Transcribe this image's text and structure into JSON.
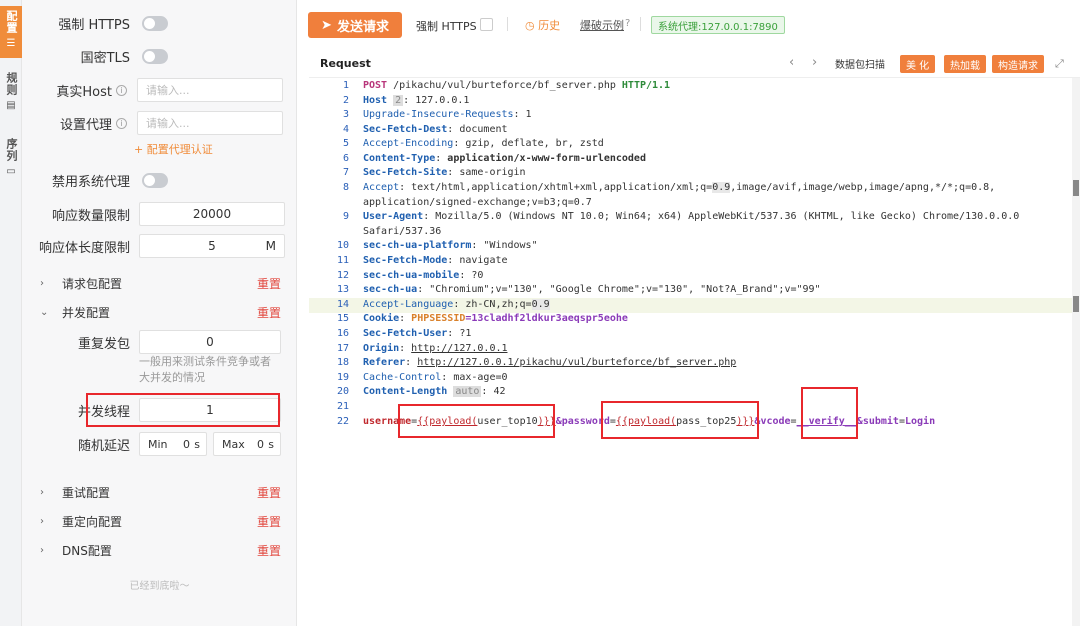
{
  "vtabs": [
    "配置",
    "规则",
    "序列"
  ],
  "settings": {
    "force_https": "强制 HTTPS",
    "gm_tls": "国密TLS",
    "real_host": "真实Host",
    "real_host_placeholder": "请输入...",
    "proxy": "设置代理",
    "proxy_placeholder": "请输入...",
    "proxy_auth": "+ 配置代理认证",
    "disable_sys_proxy": "禁用系统代理",
    "resp_count_label": "响应数量限制",
    "resp_count_value": "20000",
    "resp_len_label": "响应体长度限制",
    "resp_len_value": "5",
    "resp_len_unit": "M"
  },
  "sections": {
    "reqpkg": "请求包配置",
    "concurrency": "并发配置",
    "retry": "重试配置",
    "redirect": "重定向配置",
    "dns": "DNS配置",
    "reset": "重置"
  },
  "concurrency": {
    "repeat_label": "重复发包",
    "repeat_value": "0",
    "hint": "一般用来测试条件竞争或者大并发的情况",
    "threads_label": "并发线程",
    "threads_value": "1",
    "delay_label": "随机延迟",
    "min_label": "Min",
    "min_value": "0",
    "max_label": "Max",
    "max_value": "0",
    "unit": "s"
  },
  "bottom_text": "已经到底啦～",
  "toolbar": {
    "send": "发送请求",
    "force_https": "强制 HTTPS",
    "history": "历史",
    "blast_example": "爆破示例",
    "proxy_tag": "系统代理:127.0.0.1:7890"
  },
  "request": {
    "title": "Request",
    "packet_scan": "数据包扫描",
    "beautify": "美 化",
    "hot_load": "热加载",
    "build_request": "构造请求",
    "prev": "‹",
    "next": "›",
    "expand": "⤢"
  },
  "code": {
    "line_numbers": [
      "1",
      "2",
      "3",
      "4",
      "5",
      "6",
      "7",
      "8",
      "",
      "9",
      "",
      "10",
      "11",
      "12",
      "13",
      "14",
      "15",
      "16",
      "17",
      "18",
      "19",
      "20",
      "21",
      "22"
    ],
    "l1": [
      "POST",
      " /pikachu/vul/burteforce/bf_server.php ",
      "HTTP/1.1"
    ],
    "l2": [
      "Host",
      "2",
      ": 127.0.0.1"
    ],
    "l3": [
      "Upgrade-Insecure-Requests",
      ": 1"
    ],
    "l4": [
      "Sec-Fetch-Dest",
      ": document"
    ],
    "l5": [
      "Accept-Encoding",
      ": gzip, deflate, br, zstd"
    ],
    "l6": [
      "Content-Type",
      ": ",
      "application/x-www-form-urlencoded"
    ],
    "l7": [
      "Sec-Fetch-Site",
      ": same-origin"
    ],
    "l8a": [
      "Accept",
      ": text/html,application/xhtml+xml,application/xml;q=",
      "0.9",
      ",image/avif,image/webp,image/apng,*/*;q=0.8,"
    ],
    "l8b": "application/signed-exchange;v=b3;q=0.7",
    "l9a": [
      "User-Agent",
      ": Mozilla/5.0 (Windows NT 10.0; Win64; x64) AppleWebKit/537.36 (KHTML, like Gecko) Chrome/130.0.0.0"
    ],
    "l9b": "Safari/537.36",
    "l10": [
      "sec-ch-ua-platform",
      ": \"Windows\""
    ],
    "l11": [
      "Sec-Fetch-Mode",
      ": navigate"
    ],
    "l12": [
      "sec-ch-ua-mobile",
      ": ?0"
    ],
    "l13": [
      "sec-ch-ua",
      ": \"Chromium\";v=\"130\", \"Google Chrome\";v=\"130\", \"Not?A_Brand\";v=\"99\""
    ],
    "l14": [
      "Accept-Language",
      ": zh-CN,zh;q=",
      "0.9"
    ],
    "l15": [
      "Cookie",
      ": ",
      "PHPSESSID",
      "=13cladhf2ldkur3aeqspr5eohe"
    ],
    "l16": [
      "Sec-Fetch-User",
      ": ?1"
    ],
    "l17": [
      "Origin",
      ": ",
      "http://127.0.0.1"
    ],
    "l18": [
      "Referer",
      ": ",
      "http://127.0.0.1/pikachu/vul/burteforce/bf_server.php"
    ],
    "l19": [
      "Cache-Control",
      ": max-age=0"
    ],
    "l20": [
      "Content-Length",
      "auto",
      ": 42"
    ],
    "l22": [
      "username",
      "=",
      "{{payload(",
      "user_top10",
      ")}}",
      "&password",
      "=",
      "{{payload(",
      "pass_top25",
      ")}}",
      "&vcode",
      "=",
      "__verify__",
      "&submit",
      "=",
      "Login"
    ]
  },
  "colors": {
    "accent": "#f07f3c",
    "reset": "#e2483f",
    "annotation": "#e8272c"
  }
}
